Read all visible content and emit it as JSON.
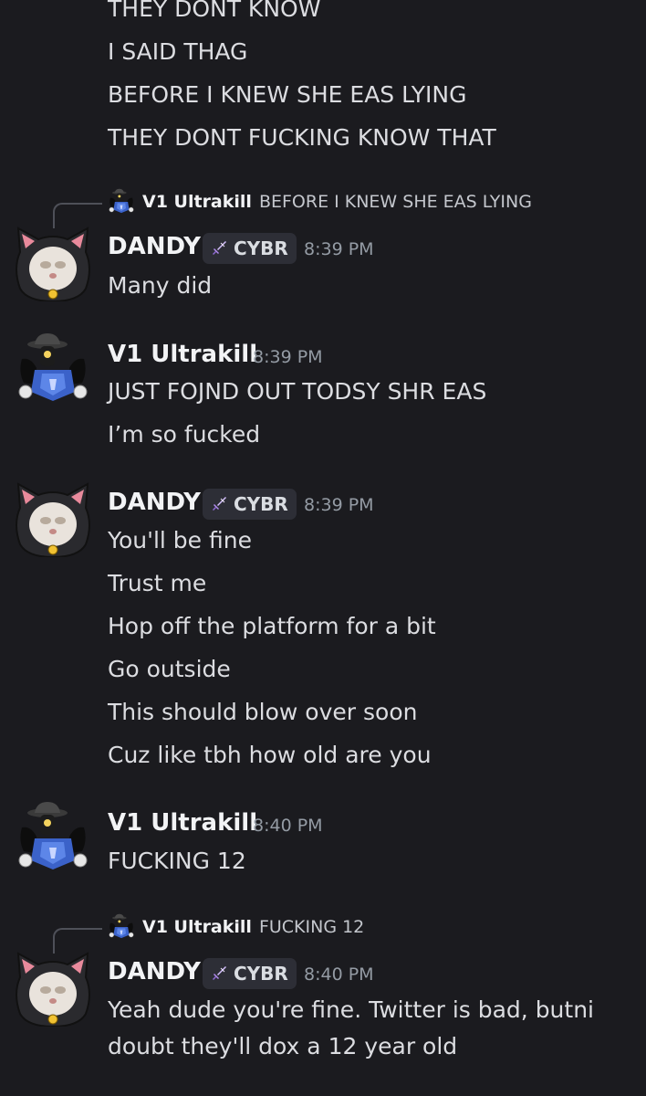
{
  "top_lines": [
    "THEY DONT KNOW",
    "I SAID THAG",
    "BEFORE I KNEW SHE EAS LYING",
    "THEY DONT FUCKING KNOW THAT"
  ],
  "messages": [
    {
      "author": "DANDY",
      "tag": "CYBR",
      "time": "8:39 PM",
      "reply": {
        "author": "V1 Ultrakill",
        "text": "BEFORE I KNEW SHE EAS LYING"
      },
      "lines": [
        "Many did"
      ]
    },
    {
      "author": "V1 Ultrakill",
      "time": "8:39 PM",
      "lines": [
        "JUST FOJND OUT TODSY SHR EAS",
        "I’m so fucked"
      ]
    },
    {
      "author": "DANDY",
      "tag": "CYBR",
      "time": "8:39 PM",
      "lines": [
        "You'll be fine",
        "Trust me",
        "Hop off the platform for a bit",
        "Go outside",
        "This should blow over soon",
        "Cuz like tbh how old are you"
      ]
    },
    {
      "author": "V1 Ultrakill",
      "time": "8:40 PM",
      "lines": [
        "FUCKING 12"
      ]
    },
    {
      "author": "DANDY",
      "tag": "CYBR",
      "time": "8:40 PM",
      "reply": {
        "author": "V1 Ultrakill",
        "text": "FUCKING 12"
      },
      "lines": [
        "Yeah dude you're fine. Twitter is bad, butni",
        "doubt they'll dox a 12 year old"
      ]
    }
  ],
  "icons": {
    "dandy_avatar": "cat-hood-avatar",
    "v1_avatar": "robot-hat-avatar",
    "tag_icon": "sword-icon"
  },
  "colors": {
    "background": "#1b1b1f",
    "text": "#dcdde1",
    "username": "#f2f3f5",
    "timestamp": "#949ba4",
    "tag_bg": "#2d2e36",
    "tag_icon": "#c9a7f7"
  }
}
